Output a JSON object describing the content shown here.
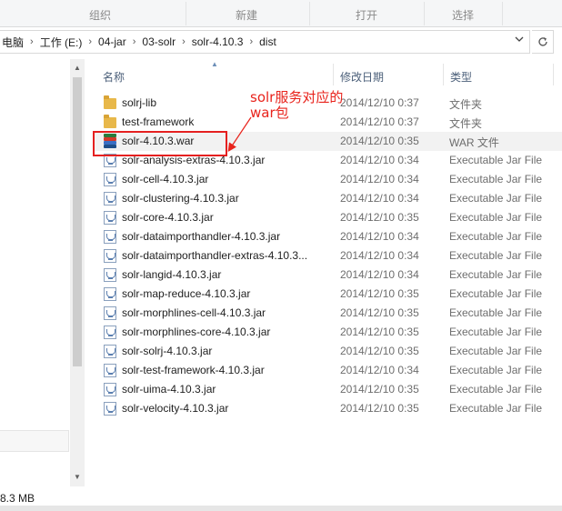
{
  "ribbon": {
    "groups": [
      "组织",
      "新建",
      "打开",
      "选择"
    ]
  },
  "address": {
    "crumbs": [
      "电脑",
      "工作 (E:)",
      "04-jar",
      "03-solr",
      "solr-4.10.3",
      "dist"
    ],
    "separator": "›",
    "dropdown_icon": "chevron-down-icon",
    "refresh_icon": "refresh-icon"
  },
  "columns": {
    "name": "名称",
    "modified": "修改日期",
    "type": "类型"
  },
  "files": [
    {
      "name": "solrj-lib",
      "date": "2014/12/10 0:37",
      "type": "文件夹",
      "icon": "folder-icon"
    },
    {
      "name": "test-framework",
      "date": "2014/12/10 0:37",
      "type": "文件夹",
      "icon": "folder-icon"
    },
    {
      "name": "solr-4.10.3.war",
      "date": "2014/12/10 0:35",
      "type": "WAR 文件",
      "icon": "war-file-icon"
    },
    {
      "name": "solr-analysis-extras-4.10.3.jar",
      "date": "2014/12/10 0:34",
      "type": "Executable Jar File",
      "icon": "jar-file-icon"
    },
    {
      "name": "solr-cell-4.10.3.jar",
      "date": "2014/12/10 0:34",
      "type": "Executable Jar File",
      "icon": "jar-file-icon"
    },
    {
      "name": "solr-clustering-4.10.3.jar",
      "date": "2014/12/10 0:34",
      "type": "Executable Jar File",
      "icon": "jar-file-icon"
    },
    {
      "name": "solr-core-4.10.3.jar",
      "date": "2014/12/10 0:35",
      "type": "Executable Jar File",
      "icon": "jar-file-icon"
    },
    {
      "name": "solr-dataimporthandler-4.10.3.jar",
      "date": "2014/12/10 0:34",
      "type": "Executable Jar File",
      "icon": "jar-file-icon"
    },
    {
      "name": "solr-dataimporthandler-extras-4.10.3...",
      "date": "2014/12/10 0:34",
      "type": "Executable Jar File",
      "icon": "jar-file-icon"
    },
    {
      "name": "solr-langid-4.10.3.jar",
      "date": "2014/12/10 0:34",
      "type": "Executable Jar File",
      "icon": "jar-file-icon"
    },
    {
      "name": "solr-map-reduce-4.10.3.jar",
      "date": "2014/12/10 0:35",
      "type": "Executable Jar File",
      "icon": "jar-file-icon"
    },
    {
      "name": "solr-morphlines-cell-4.10.3.jar",
      "date": "2014/12/10 0:35",
      "type": "Executable Jar File",
      "icon": "jar-file-icon"
    },
    {
      "name": "solr-morphlines-core-4.10.3.jar",
      "date": "2014/12/10 0:35",
      "type": "Executable Jar File",
      "icon": "jar-file-icon"
    },
    {
      "name": "solr-solrj-4.10.3.jar",
      "date": "2014/12/10 0:35",
      "type": "Executable Jar File",
      "icon": "jar-file-icon"
    },
    {
      "name": "solr-test-framework-4.10.3.jar",
      "date": "2014/12/10 0:34",
      "type": "Executable Jar File",
      "icon": "jar-file-icon"
    },
    {
      "name": "solr-uima-4.10.3.jar",
      "date": "2014/12/10 0:35",
      "type": "Executable Jar File",
      "icon": "jar-file-icon"
    },
    {
      "name": "solr-velocity-4.10.3.jar",
      "date": "2014/12/10 0:35",
      "type": "Executable Jar File",
      "icon": "jar-file-icon"
    }
  ],
  "annotation": {
    "text": "solr服务对应的war包",
    "color": "#e8231c"
  },
  "status": {
    "size_text": "8.3 MB"
  },
  "colors": {
    "header_text": "#4c607a",
    "secondary_text": "#6d6d6d",
    "hover_row": "#f2f2f2"
  }
}
